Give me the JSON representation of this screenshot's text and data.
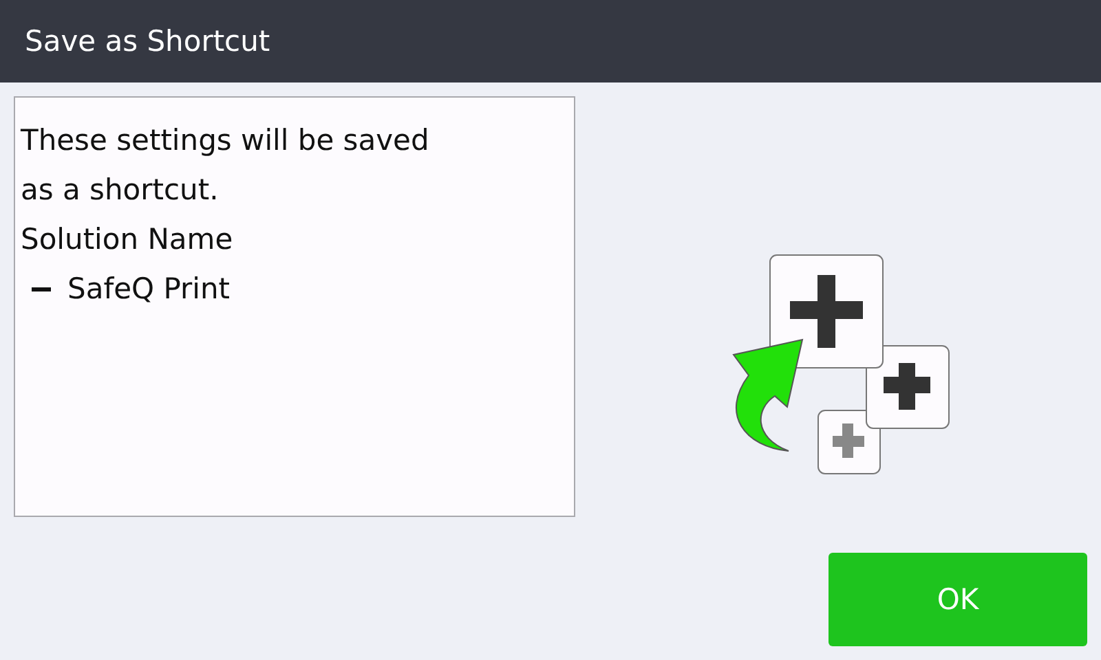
{
  "window": {
    "title": "Save as Shortcut"
  },
  "message": {
    "lines": [
      "These settings will be saved",
      "as a shortcut.",
      "Solution Name"
    ],
    "items": [
      {
        "label": "SafeQ Print"
      }
    ]
  },
  "buttons": [
    {
      "label": "OK"
    }
  ]
}
